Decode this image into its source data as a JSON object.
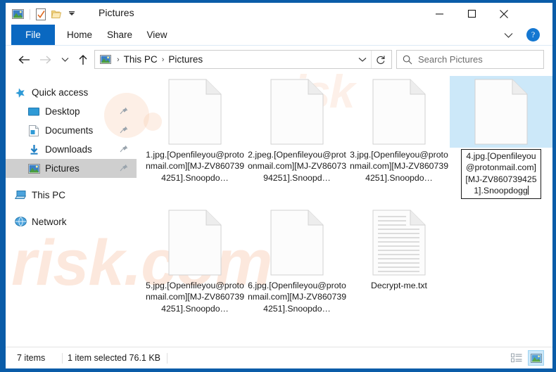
{
  "window": {
    "title": "Pictures",
    "minimize_label": "–",
    "maximize_label": "□",
    "close_label": "✕",
    "help_label": "?"
  },
  "quick_access_toolbar": {
    "items": [
      {
        "name": "pictures-icon",
        "label": ""
      },
      {
        "name": "properties-icon",
        "label": ""
      },
      {
        "name": "new-folder-icon",
        "label": ""
      },
      {
        "name": "customize-dropdown-icon",
        "label": "▾"
      }
    ]
  },
  "ribbon": {
    "tabs": [
      {
        "label": "File",
        "selected": true
      },
      {
        "label": "Home",
        "selected": false
      },
      {
        "label": "Share",
        "selected": false
      },
      {
        "label": "View",
        "selected": false
      }
    ],
    "collapse_icon": "⌄"
  },
  "navigation": {
    "back_icon": "←",
    "forward_icon": "→",
    "recent_icon": "⌵",
    "up_icon": "↑",
    "breadcrumb": [
      {
        "label": "This PC"
      },
      {
        "label": "Pictures"
      }
    ],
    "separator": "›",
    "dropdown_icon": "⌵",
    "refresh_icon": "↻"
  },
  "search": {
    "placeholder": "Search Pictures",
    "icon": "⚲"
  },
  "sidebar": {
    "items": [
      {
        "label": "Quick access",
        "icon": "star-icon",
        "indent": false,
        "pinned": false,
        "selected": false
      },
      {
        "label": "Desktop",
        "icon": "desktop-icon",
        "indent": true,
        "pinned": true,
        "selected": false
      },
      {
        "label": "Documents",
        "icon": "documents-icon",
        "indent": true,
        "pinned": true,
        "selected": false
      },
      {
        "label": "Downloads",
        "icon": "downloads-icon",
        "indent": true,
        "pinned": true,
        "selected": false
      },
      {
        "label": "Pictures",
        "icon": "pictures-icon",
        "indent": true,
        "pinned": true,
        "selected": true
      },
      {
        "label": "This PC",
        "icon": "thispc-icon",
        "indent": false,
        "pinned": false,
        "selected": false
      },
      {
        "label": "Network",
        "icon": "network-icon",
        "indent": false,
        "pinned": false,
        "selected": false
      }
    ]
  },
  "files": [
    {
      "name": "1.jpg.[Openfileyou@protonmail.com][MJ-ZV8607394251].Snoopdo…",
      "icon": "blank-file-icon",
      "selected": false,
      "editing": false
    },
    {
      "name": "2.jpeg.[Openfileyou@protonmail.com][MJ-ZV8607394251].Snoopd…",
      "icon": "blank-file-icon",
      "selected": false,
      "editing": false
    },
    {
      "name": "3.jpg.[Openfileyou@protonmail.com][MJ-ZV8607394251].Snoopdo…",
      "icon": "blank-file-icon",
      "selected": false,
      "editing": false
    },
    {
      "name": "4.jpg.[Openfileyou@protonmail.com][MJ-ZV8607394251].Snoopdogg",
      "icon": "blank-file-icon",
      "selected": true,
      "editing": true
    },
    {
      "name": "5.jpg.[Openfileyou@protonmail.com][MJ-ZV8607394251].Snoopdo…",
      "icon": "blank-file-icon",
      "selected": false,
      "editing": false
    },
    {
      "name": "6.jpg.[Openfileyou@protonmail.com][MJ-ZV8607394251].Snoopdo…",
      "icon": "blank-file-icon",
      "selected": false,
      "editing": false
    },
    {
      "name": "Decrypt-me.txt",
      "icon": "text-file-icon",
      "selected": false,
      "editing": false
    }
  ],
  "status_bar": {
    "item_count": "7 items",
    "selection": "1 item selected  76.1 KB",
    "view_details_icon": "details-view-icon",
    "view_icons_icon": "large-icons-view-icon"
  },
  "watermark": {
    "top_text": "risk",
    "bottom_text": "risk.com"
  },
  "colors": {
    "window_frame": "#0a5ca8",
    "file_tab": "#0a68c1",
    "selection": "#cce8f9",
    "sidebar_selection": "#cfcfcf",
    "help_button": "#1477d1"
  }
}
